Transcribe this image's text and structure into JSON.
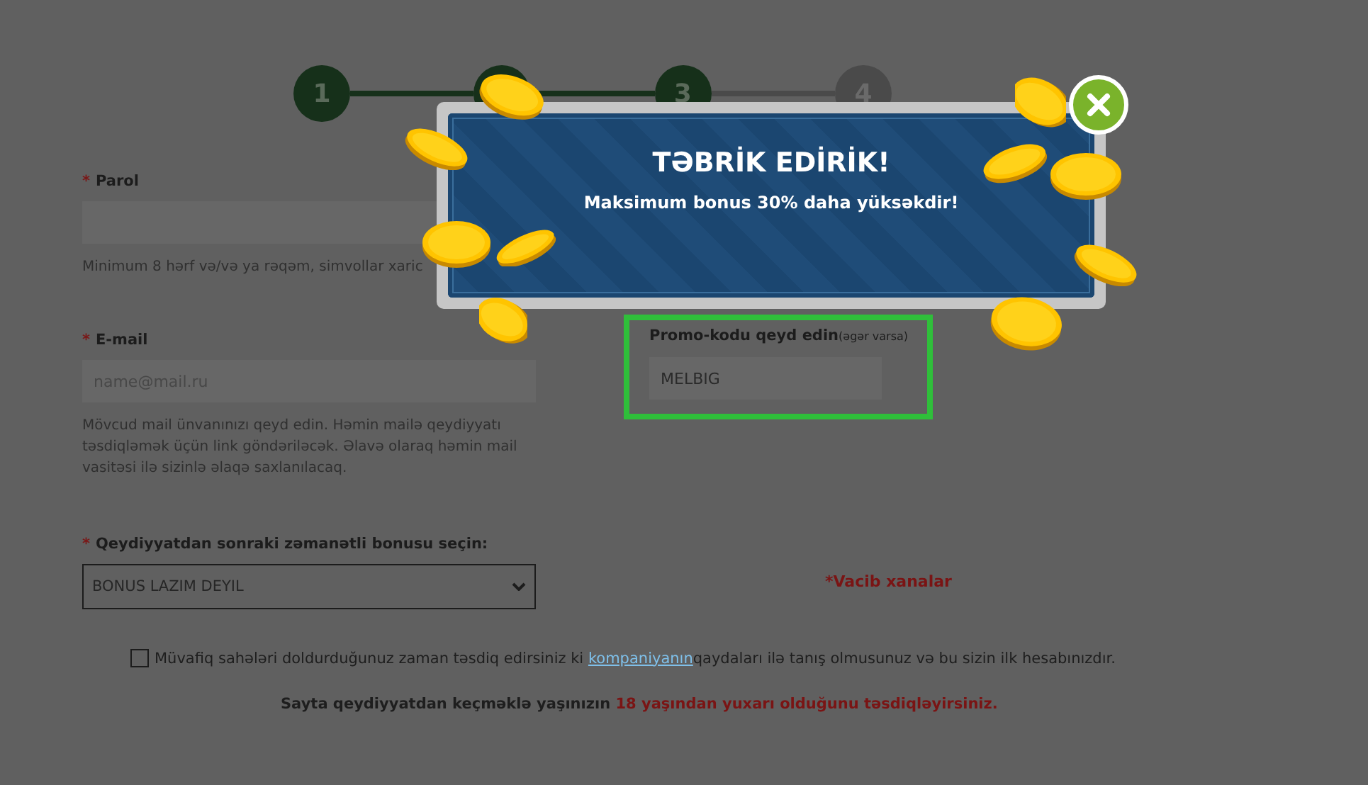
{
  "steps": [
    {
      "label": "1",
      "done": true
    },
    {
      "done": true
    },
    {
      "label": "3",
      "done": true
    },
    {
      "label": "4",
      "done": false
    }
  ],
  "password": {
    "label": "Parol",
    "mark": "*",
    "hint": "Minimum 8 hərf və/və ya rəqəm, simvollar xaric"
  },
  "email": {
    "label": "E-mail",
    "mark": "*",
    "placeholder": "name@mail.ru",
    "hint": "Mövcud mail ünvanınızı qeyd edin. Həmin mailə qeydiyyatı təsdiqləmək üçün link göndəriləcək. Əlavə olaraq həmin mail vasitəsi ilə sizinlə əlaqə saxlanılacaq."
  },
  "promo": {
    "label": "Promo-kodu qeyd edin",
    "note": "(əgər varsa)",
    "value": "MELBIG",
    "highlighted": true
  },
  "bonus": {
    "label": "Qeydiyyatdan sonraki zəmanətli bonusu seçin:",
    "mark": "*",
    "value": "BONUS LAZIM DEYIL"
  },
  "required_note": "*Vacib xanalar",
  "agreement": {
    "checked": false,
    "before": "Müvafiq sahələri doldurduğunuz zaman təsdiq edirsiniz ki",
    "link": "kompaniyanın",
    "after": "qaydaları ilə tanış olmusunuz və bu sizin ilk hesabınızdır."
  },
  "age_notice": {
    "text": "Sayta qeydiyyatdan keçməklə yaşınızın",
    "highlight": "18 yaşından yuxarı olduğunu təsdiqləyirsiniz."
  },
  "modal": {
    "title": "TƏBRİK EDİRİK!",
    "message": "Maksimum bonus 30% daha yüksəkdir!"
  }
}
